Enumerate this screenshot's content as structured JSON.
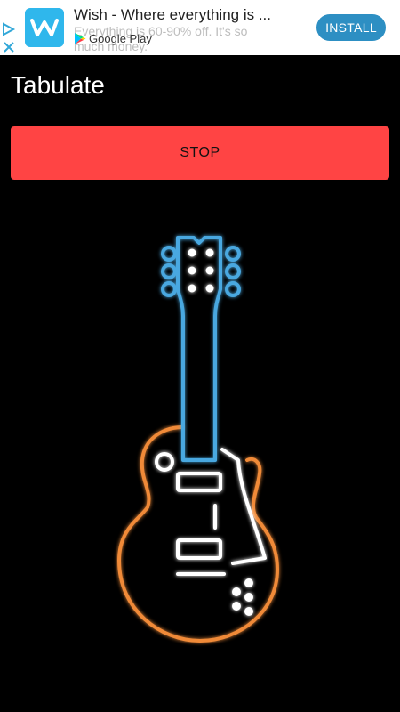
{
  "ad": {
    "title": "Wish - Where everything is ...",
    "subtitle": "Everything is 60-90% off. It's so much money.",
    "store": "Google Play",
    "install_label": "INSTALL",
    "logo_letter": "w",
    "colors": {
      "logo": "#2fb7ec",
      "install": "#2d8fc3"
    }
  },
  "app": {
    "title": "Tabulate",
    "stop_label": "STOP",
    "colors": {
      "stop": "#ff4444",
      "background": "#000000"
    }
  },
  "guitar": {
    "icon": "neon-electric-guitar",
    "colors": {
      "neck": "#4aa8e0",
      "body": "#f08a38",
      "detail": "#ffffff"
    }
  }
}
